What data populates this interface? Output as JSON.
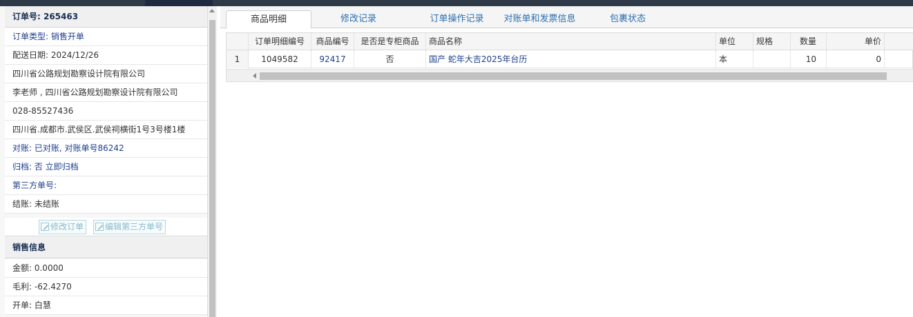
{
  "order": {
    "title": "订单号: 265463",
    "type": "订单类型: 销售开单",
    "date": "配送日期: 2024/12/26",
    "company": "四川省公路规划勘察设计院有限公司",
    "contact": "李老师 , 四川省公路规划勘察设计院有限公司",
    "phone": "028-85527436",
    "address": "四川省.成都市.武侯区.武侯祠横街1号3号楼1楼",
    "reconcile": "对账: 已对账, 对账单号86242",
    "archive": "归档:  否 立即归档",
    "third_party": "第三方单号:",
    "settle": "结账: 未结账",
    "btn_edit_order": "修改订单",
    "btn_edit_third": "编辑第三方单号"
  },
  "sales": {
    "title": "销售信息",
    "amount": "金额:  0.0000",
    "profit": "毛利:  -62.4270",
    "opener": "开单:  白慧"
  },
  "tabs": [
    "商品明细",
    "修改记录",
    "订单操作记录",
    "对账单和发票信息",
    "包裹状态"
  ],
  "grid": {
    "headers": [
      "订单明细编号",
      "商品编号",
      "是否是专柜商品",
      "商品名称",
      "单位",
      "规格",
      "数量",
      "单价"
    ],
    "rows": [
      [
        "1",
        "1049582",
        "92417",
        "否",
        "国产 蛇年大吉2025年台历",
        "本",
        "",
        "10",
        "0"
      ]
    ]
  }
}
